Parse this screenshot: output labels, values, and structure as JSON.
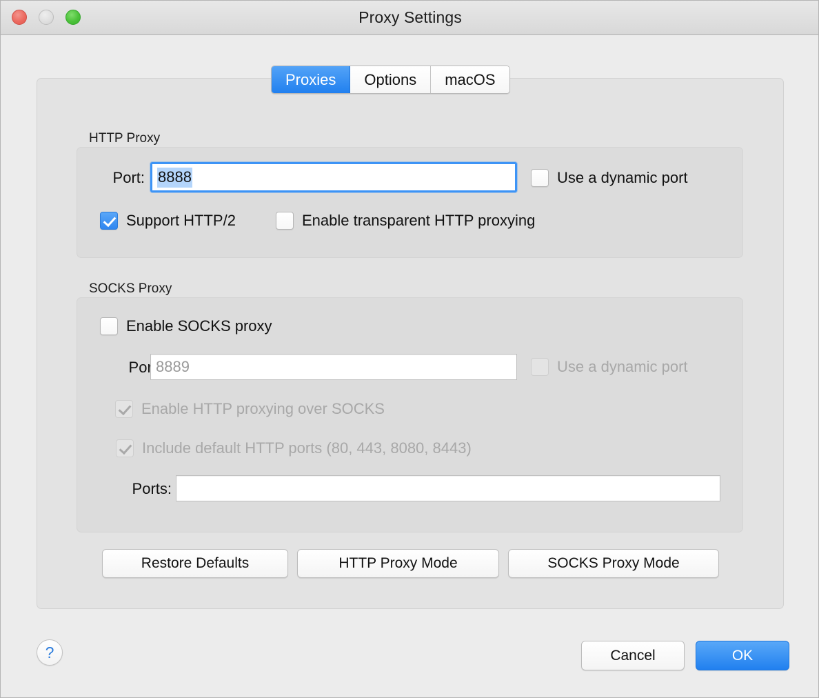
{
  "window": {
    "title": "Proxy Settings",
    "traffic_lights": [
      {
        "name": "close",
        "color": "#ec6a60"
      },
      {
        "name": "minimize",
        "color": "#dedede"
      },
      {
        "name": "zoom",
        "color": "#4cc13a"
      }
    ],
    "accent_color": "#2180ef"
  },
  "tabs": [
    {
      "label": "Proxies",
      "selected": true
    },
    {
      "label": "Options",
      "selected": false
    },
    {
      "label": "macOS",
      "selected": false
    }
  ],
  "http_proxy": {
    "group_label": "HTTP Proxy",
    "port_label": "Port:",
    "port_value": "8888",
    "port_focused": true,
    "dynamic_port": {
      "label": "Use a dynamic port",
      "checked": false,
      "disabled": false
    },
    "support_http2": {
      "label": "Support HTTP/2",
      "checked": true,
      "disabled": false
    },
    "transparent_proxying": {
      "label": "Enable transparent HTTP proxying",
      "checked": false,
      "disabled": false
    }
  },
  "socks_proxy": {
    "group_label": "SOCKS Proxy",
    "enable_socks": {
      "label": "Enable SOCKS proxy",
      "checked": false,
      "disabled": false
    },
    "port_label": "Port:",
    "port_placeholder": "8889",
    "port_value": "",
    "dynamic_port": {
      "label": "Use a dynamic port",
      "checked": false,
      "disabled": true
    },
    "http_over_socks": {
      "label": "Enable HTTP proxying over SOCKS",
      "checked": true,
      "disabled": true
    },
    "default_http_ports": {
      "label": "Include default HTTP ports (80, 443, 8080, 8443)",
      "checked": true,
      "disabled": true
    },
    "ports_label": "Ports:",
    "ports_value": ""
  },
  "mode_buttons": {
    "restore_defaults": "Restore Defaults",
    "http_proxy_mode": "HTTP Proxy Mode",
    "socks_proxy_mode": "SOCKS Proxy Mode"
  },
  "footer": {
    "help": "?",
    "cancel": "Cancel",
    "ok": "OK"
  }
}
